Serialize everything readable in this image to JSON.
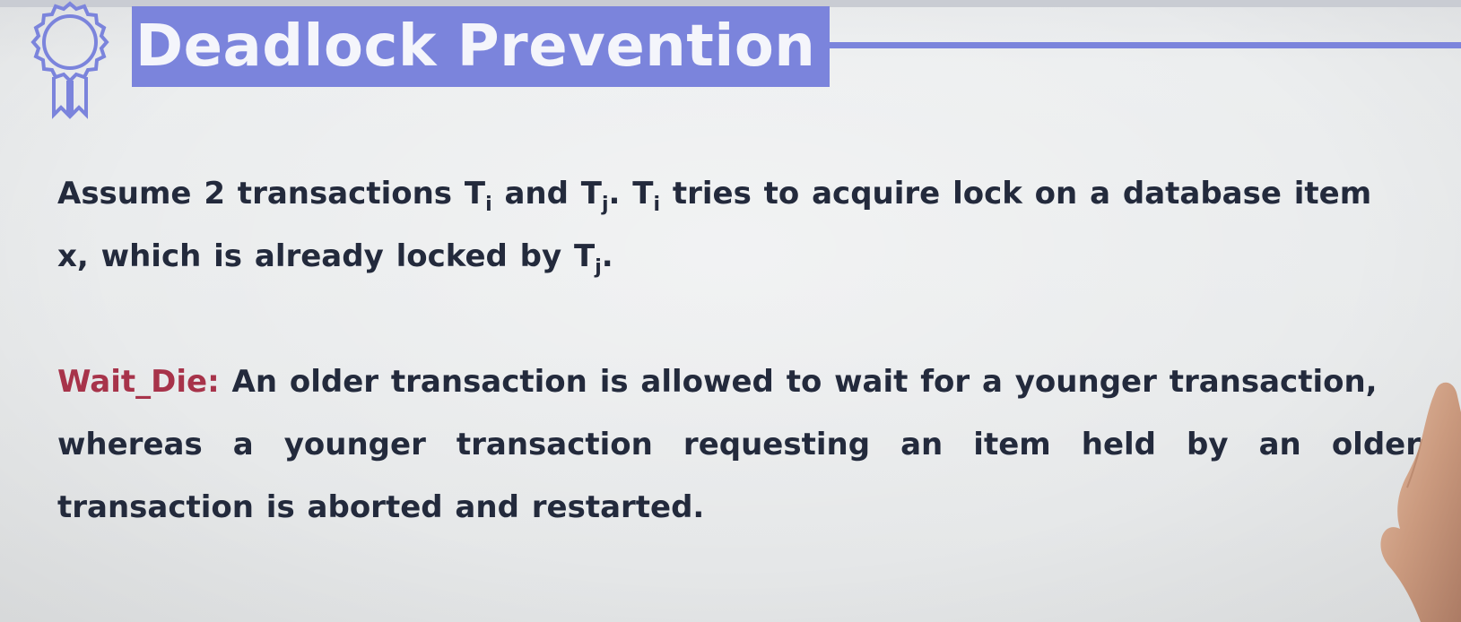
{
  "slide": {
    "title": "Deadlock Prevention",
    "colors": {
      "accent": "#7b84dc",
      "title_text": "#f4f5fb",
      "body_text": "#232a3c",
      "term": "#a7334a",
      "background": "#e9ebec"
    },
    "badge_icon": "award-ribbon-icon"
  },
  "para1": {
    "t1": "Assume 2 transactions T",
    "s1": "i",
    "t2": " and T",
    "s2": "j",
    "t3": ". T",
    "s3": "i",
    "t4": " tries to acquire lock on a database item",
    "t5": "x, which is already locked by T",
    "s4": "j",
    "t6": "."
  },
  "para2": {
    "term": "Wait_Die:",
    "line1": " An older transaction is allowed to wait for a younger transaction,",
    "line2": "whereas a younger transaction requesting an item held by an older",
    "line3": "transaction is aborted and restarted."
  }
}
